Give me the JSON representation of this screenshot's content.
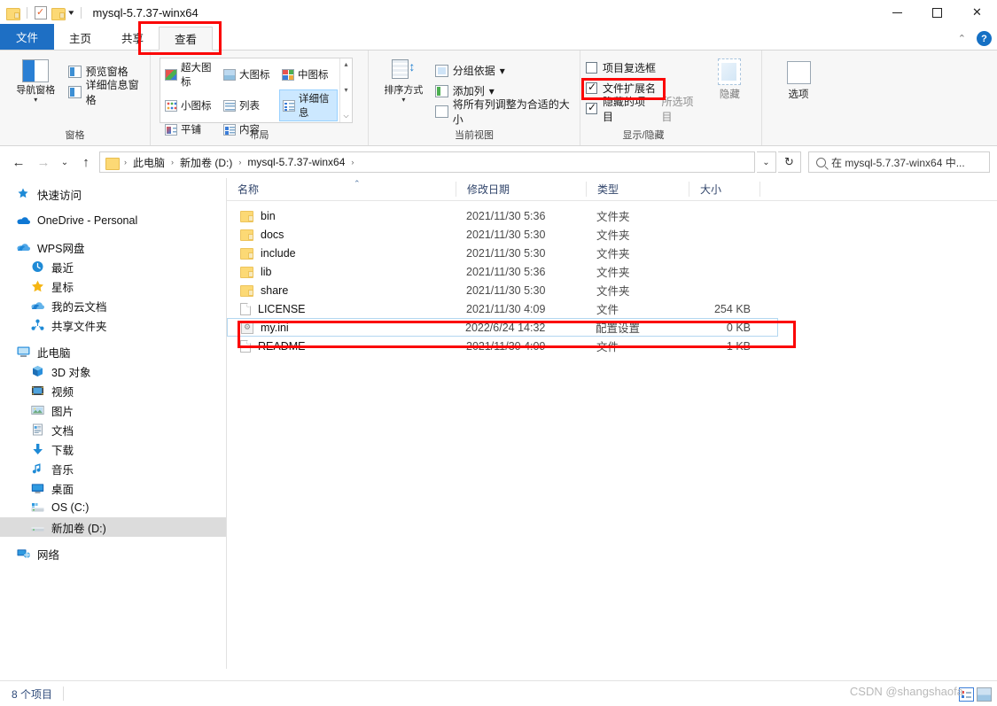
{
  "window": {
    "title": "mysql-5.7.37-winx64",
    "minimize_label": "—",
    "maximize_label": "",
    "close_label": "✕",
    "collapse_ribbon_label": "⌃",
    "help_label": "?"
  },
  "quick_access": {
    "folder_icon": "folder-icon",
    "properties_icon": "properties-icon",
    "new_folder_icon": "new-folder-icon",
    "caret_label": "▾"
  },
  "tabs": [
    {
      "label": "文件",
      "kind": "file"
    },
    {
      "label": "主页",
      "kind": "normal"
    },
    {
      "label": "共享",
      "kind": "normal"
    },
    {
      "label": "查看",
      "kind": "active"
    }
  ],
  "ribbon": {
    "groups": [
      {
        "name": "panes",
        "label": "窗格"
      },
      {
        "name": "layout",
        "label": "布局"
      },
      {
        "name": "current_view",
        "label": "当前视图"
      },
      {
        "name": "show_hide",
        "label": "显示/隐藏"
      }
    ],
    "panes": {
      "nav_pane": "导航窗格",
      "nav_pane_arrow": "▾",
      "preview_pane": "预览窗格",
      "details_pane": "详细信息窗格"
    },
    "layout": {
      "items": [
        {
          "label": "超大图标",
          "icon": "extra-large-icons-icon",
          "selected": false
        },
        {
          "label": "大图标",
          "icon": "large-icons-icon",
          "selected": false
        },
        {
          "label": "中图标",
          "icon": "medium-icons-icon",
          "selected": false
        },
        {
          "label": "小图标",
          "icon": "small-icons-icon",
          "selected": false
        },
        {
          "label": "列表",
          "icon": "list-icon",
          "selected": false
        },
        {
          "label": "详细信息",
          "icon": "details-icon",
          "selected": true
        },
        {
          "label": "平铺",
          "icon": "tiles-icon",
          "selected": false
        },
        {
          "label": "内容",
          "icon": "content-icon",
          "selected": false
        }
      ],
      "scroll_up": "▴",
      "scroll_down": "▾",
      "scroll_more": "⌵"
    },
    "current_view": {
      "sort_by": "排序方式",
      "sort_by_arrow": "▾",
      "group_by": "分组依据",
      "group_by_arrow": "▾",
      "add_column": "添加列",
      "add_column_arrow": "▾",
      "size_all_columns": "将所有列调整为合适的大小"
    },
    "show_hide": {
      "item_checkboxes": {
        "label": "项目复选框",
        "checked": false
      },
      "file_extensions": {
        "label": "文件扩展名",
        "checked": true
      },
      "hidden_items": {
        "label": "隐藏的项目",
        "checked": true
      },
      "hide_button": "隐藏",
      "selected_items": "所选项目",
      "options_button": "选项"
    }
  },
  "address_bar": {
    "back_label": "←",
    "forward_label": "→",
    "recent_label": "⌄",
    "up_label": "↑",
    "refresh_label": "↻",
    "dropdown_label": "⌄",
    "breadcrumbs": [
      "此电脑",
      "新加卷 (D:)",
      "mysql-5.7.37-winx64"
    ],
    "separator": "›",
    "search_placeholder": "在 mysql-5.7.37-winx64 中...",
    "search_icon": "search-icon"
  },
  "sidebar": {
    "groups": [
      {
        "items": [
          {
            "label": "快速访问",
            "icon": "star-pin-icon",
            "indent": false,
            "selected": false
          }
        ]
      },
      {
        "items": [
          {
            "label": "OneDrive - Personal",
            "icon": "onedrive-icon",
            "indent": false,
            "selected": false
          }
        ]
      },
      {
        "items": [
          {
            "label": "WPS网盘",
            "icon": "wps-cloud-icon",
            "indent": false,
            "selected": false
          },
          {
            "label": "最近",
            "icon": "clock-icon",
            "indent": true,
            "selected": false
          },
          {
            "label": "星标",
            "icon": "star-icon",
            "indent": true,
            "selected": false
          },
          {
            "label": "我的云文档",
            "icon": "cloud-doc-icon",
            "indent": true,
            "selected": false
          },
          {
            "label": "共享文件夹",
            "icon": "shared-folder-icon",
            "indent": true,
            "selected": false
          }
        ]
      },
      {
        "items": [
          {
            "label": "此电脑",
            "icon": "this-pc-icon",
            "indent": false,
            "selected": false
          },
          {
            "label": "3D 对象",
            "icon": "3d-objects-icon",
            "indent": true,
            "selected": false
          },
          {
            "label": "视频",
            "icon": "videos-icon",
            "indent": true,
            "selected": false
          },
          {
            "label": "图片",
            "icon": "pictures-icon",
            "indent": true,
            "selected": false
          },
          {
            "label": "文档",
            "icon": "documents-icon",
            "indent": true,
            "selected": false
          },
          {
            "label": "下载",
            "icon": "downloads-icon",
            "indent": true,
            "selected": false
          },
          {
            "label": "音乐",
            "icon": "music-icon",
            "indent": true,
            "selected": false
          },
          {
            "label": "桌面",
            "icon": "desktop-icon",
            "indent": true,
            "selected": false
          },
          {
            "label": "OS (C:)",
            "icon": "local-disk-icon",
            "indent": true,
            "selected": false
          },
          {
            "label": "新加卷 (D:)",
            "icon": "local-disk-icon",
            "indent": true,
            "selected": true
          }
        ]
      },
      {
        "items": [
          {
            "label": "网络",
            "icon": "network-icon",
            "indent": false,
            "selected": false
          }
        ]
      }
    ]
  },
  "file_list": {
    "columns": [
      {
        "label": "名称",
        "key": "name"
      },
      {
        "label": "修改日期",
        "key": "date"
      },
      {
        "label": "类型",
        "key": "type"
      },
      {
        "label": "大小",
        "key": "size"
      }
    ],
    "sort_indicator": "⌃",
    "rows": [
      {
        "name": "bin",
        "date": "2021/11/30 5:36",
        "type": "文件夹",
        "size": "",
        "icon": "folder-icon",
        "selected": false
      },
      {
        "name": "docs",
        "date": "2021/11/30 5:30",
        "type": "文件夹",
        "size": "",
        "icon": "folder-icon",
        "selected": false
      },
      {
        "name": "include",
        "date": "2021/11/30 5:30",
        "type": "文件夹",
        "size": "",
        "icon": "folder-icon",
        "selected": false
      },
      {
        "name": "lib",
        "date": "2021/11/30 5:36",
        "type": "文件夹",
        "size": "",
        "icon": "folder-icon",
        "selected": false
      },
      {
        "name": "share",
        "date": "2021/11/30 5:30",
        "type": "文件夹",
        "size": "",
        "icon": "folder-icon",
        "selected": false
      },
      {
        "name": "LICENSE",
        "date": "2021/11/30 4:09",
        "type": "文件",
        "size": "254 KB",
        "icon": "file-icon",
        "selected": false
      },
      {
        "name": "my.ini",
        "date": "2022/6/24 14:32",
        "type": "配置设置",
        "size": "0 KB",
        "icon": "config-file-icon",
        "selected": true
      },
      {
        "name": "README",
        "date": "2021/11/30 4:09",
        "type": "文件",
        "size": "1 KB",
        "icon": "file-icon",
        "selected": false
      }
    ]
  },
  "status_bar": {
    "item_count": "8 个项目",
    "view_details_icon": "details-view-icon",
    "view_large_icon": "large-icons-view-icon"
  },
  "watermark": {
    "text": "CSDN @shangshaofa"
  },
  "annotations": {
    "view_tab_box": "red-highlight-view-tab",
    "file_extensions_box": "red-highlight-file-extensions",
    "my_ini_box": "red-highlight-my-ini-row"
  },
  "colors": {
    "accent": "#1e6fc4",
    "annotation": "#fb0505",
    "selection": "#cce8ff"
  }
}
